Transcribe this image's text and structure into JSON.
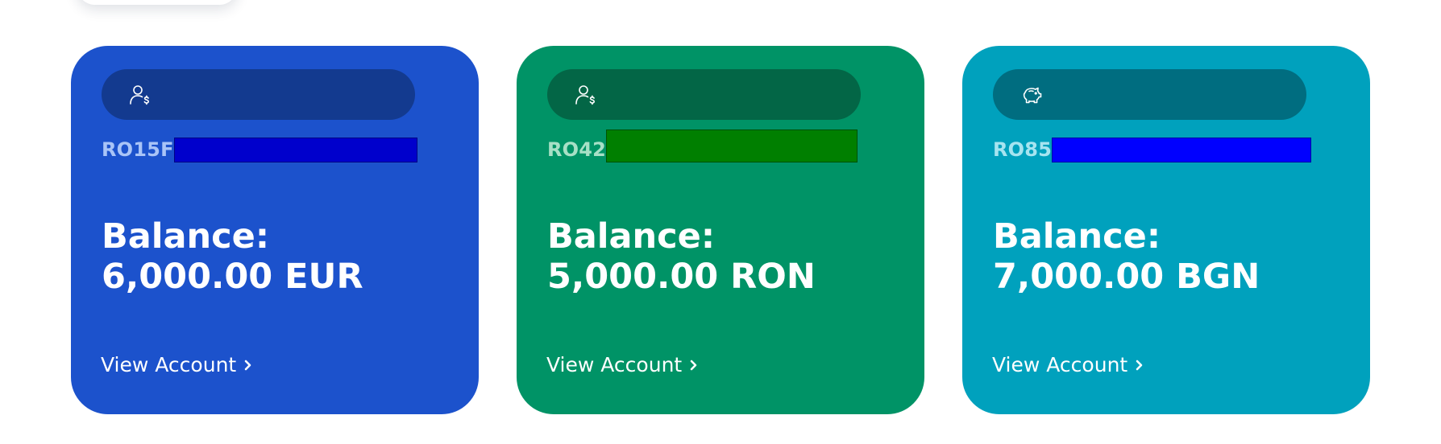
{
  "cards": [
    {
      "icon": "user-dollar-icon",
      "iban_prefix": "RO15F",
      "balance_label": "Balance:",
      "balance_value": "6,000.00 EUR",
      "link_label": "View Account",
      "colors": {
        "card": "#1c52cc",
        "header": "#133a8f",
        "iban_text": "#a9c4f7",
        "mask": "#0000cc"
      }
    },
    {
      "icon": "user-dollar-icon",
      "iban_prefix": "RO42",
      "balance_label": "Balance:",
      "balance_value": "5,000.00 RON",
      "link_label": "View Account",
      "colors": {
        "card": "#009366",
        "header": "#036646",
        "iban_text": "#a7e0c6",
        "mask": "#007f00"
      }
    },
    {
      "icon": "piggy-bank-icon",
      "iban_prefix": "RO85",
      "balance_label": "Balance:",
      "balance_value": "7,000.00 BGN",
      "link_label": "View Account",
      "colors": {
        "card": "#00a1bd",
        "header": "#006d80",
        "iban_text": "#a6e4f0",
        "mask": "#0000ff"
      }
    }
  ]
}
